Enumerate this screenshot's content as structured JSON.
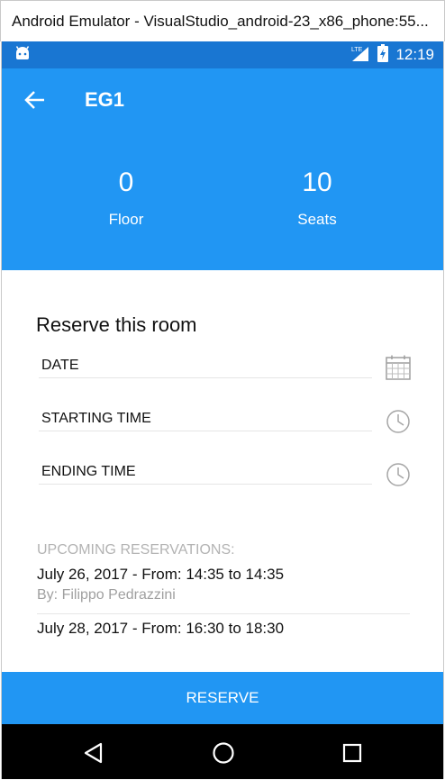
{
  "window": {
    "title": "Android Emulator - VisualStudio_android-23_x86_phone:55..."
  },
  "statusbar": {
    "time": "12:19",
    "network_label": "LTE"
  },
  "header": {
    "room_name": "EG1",
    "floor_value": "0",
    "floor_label": "Floor",
    "seats_value": "10",
    "seats_label": "Seats"
  },
  "reserve_form": {
    "title": "Reserve this room",
    "date_label": "DATE",
    "start_label": "STARTING TIME",
    "end_label": "ENDING TIME"
  },
  "upcoming": {
    "label": "UPCOMING RESERVATIONS:",
    "items": [
      {
        "date": "July 26, 2017 - From: 14:35 to 14:35",
        "by": "By: Filippo Pedrazzini"
      },
      {
        "date": "July 28, 2017 - From: 16:30 to 18:30"
      }
    ]
  },
  "actions": {
    "reserve_label": "RESERVE"
  },
  "colors": {
    "primary": "#2196f3",
    "primary_dark": "#1976d2",
    "navbar": "#000000"
  }
}
